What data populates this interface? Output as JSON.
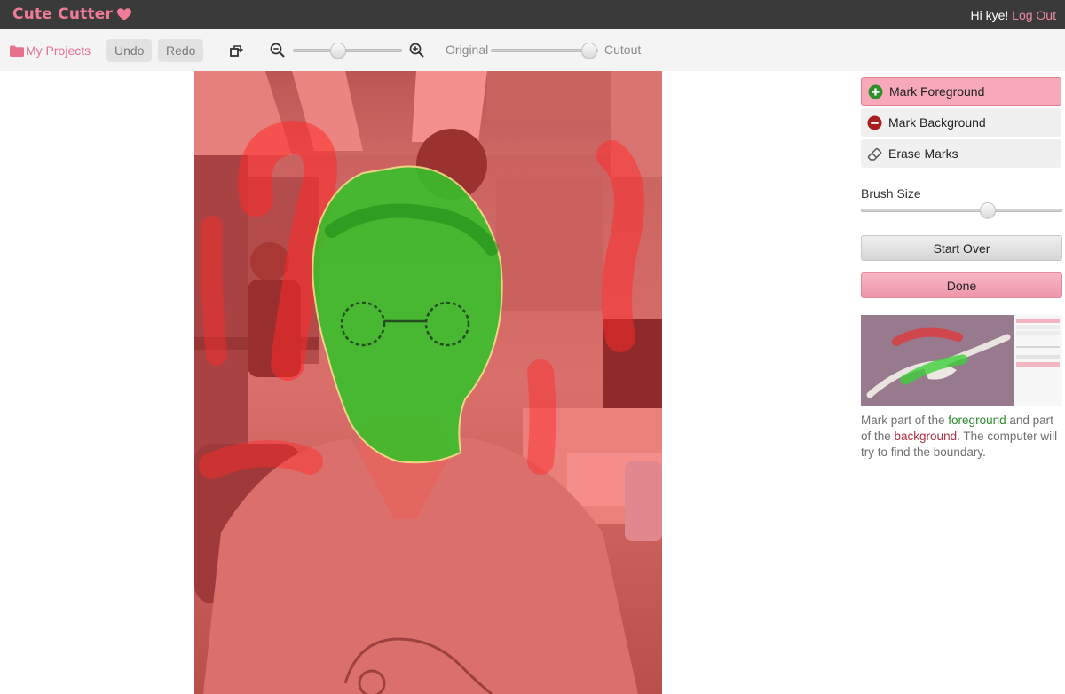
{
  "app": {
    "title": "Cute Cutter",
    "greeting": "Hi kye!",
    "logout_label": "Log Out",
    "brand_color": "#ef7b97"
  },
  "toolbar": {
    "projects_label": "My Projects",
    "undo_label": "Undo",
    "redo_label": "Redo",
    "rotate_icon": "rotate-icon",
    "zoom_out_icon": "zoom-out-icon",
    "zoom_in_icon": "zoom-in-icon",
    "zoom_level": 0.4,
    "view_left_label": "Original",
    "view_right_label": "Cutout",
    "view_mix": 0.99
  },
  "panel": {
    "modes": [
      {
        "label": "Mark Foreground",
        "icon": "plus-circle-icon",
        "active": true
      },
      {
        "label": "Mark Background",
        "icon": "minus-circle-icon",
        "active": false
      },
      {
        "label": "Erase Marks",
        "icon": "eraser-icon",
        "active": false
      }
    ],
    "brush_size_label": "Brush Size",
    "brush_size": 0.64,
    "start_over_label": "Start Over",
    "done_label": "Done",
    "help": {
      "part1": "Mark part of the ",
      "foreground_word": "foreground",
      "part2": " and part of the ",
      "background_word": "background",
      "part3": ". The computer will try to find the boundary."
    }
  },
  "colors": {
    "foreground_mark": "#3fbf2f",
    "background_mark": "#f06a6a",
    "active_mode": "#f7a9b9"
  }
}
